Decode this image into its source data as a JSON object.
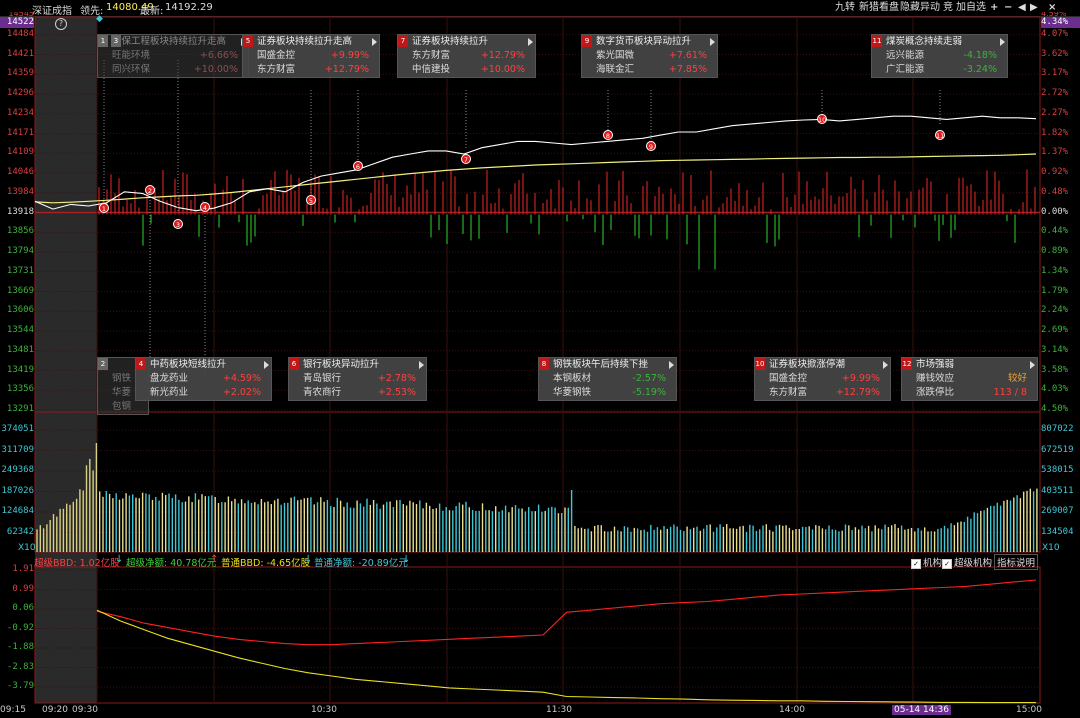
{
  "header": {
    "index_name": "深证成指",
    "prev_close_label": "领先:",
    "prev_close_value": "14080.49",
    "latest_label": "最新:",
    "latest_value": "14192.29",
    "top_left_value": "14522",
    "top_right_pct": "4.34%",
    "help_icon_label": "?"
  },
  "toolbar": {
    "items": [
      "九转",
      "新猎看盘",
      "隐藏异动",
      "竞",
      "加自选"
    ]
  },
  "price_axis": {
    "left_labels": [
      "14484",
      "14421",
      "14359",
      "14296",
      "14234",
      "14171",
      "14109",
      "14046",
      "13984",
      "13918",
      "13856",
      "13794",
      "13731",
      "13669",
      "13606",
      "13544",
      "13481",
      "13419",
      "13356",
      "13291"
    ],
    "right_labels": [
      "4.07%",
      "3.62%",
      "3.17%",
      "2.72%",
      "2.27%",
      "1.82%",
      "1.37%",
      "0.92%",
      "0.48%",
      "0.00%",
      "0.44%",
      "0.89%",
      "1.34%",
      "1.79%",
      "2.24%",
      "2.69%",
      "3.14%",
      "3.58%",
      "4.03%",
      "4.50%"
    ],
    "top_hidden_left": "14545",
    "top_hidden_right": "4.59%"
  },
  "volume_axis": {
    "left_labels": [
      "374051",
      "311709",
      "249368",
      "187026",
      "124684",
      "62342"
    ],
    "right_labels": [
      "807022",
      "672519",
      "538015",
      "403511",
      "269007",
      "134504"
    ],
    "multiplier": "X10"
  },
  "bbd_axis": {
    "left_labels": [
      "1.91",
      "0.99",
      "0.06",
      "-0.92",
      "-1.88",
      "-2.83",
      "-3.79"
    ]
  },
  "bbd_legend": {
    "super_bbd": "超级BBD: 1.02亿股",
    "super_net": "超级净额: 40.78亿元",
    "normal_bbd": "普通BBD: -4.65亿股",
    "normal_net": "普通净额: -20.89亿元",
    "chk_inst": "机构",
    "chk_super_inst": "超级机构",
    "indicator_help": "指标说明"
  },
  "time_axis": [
    "09:15",
    "09:20",
    "09:30",
    "10:30",
    "11:30",
    "14:00",
    "05-14 14:36",
    "15:00"
  ],
  "annotations_top": [
    {
      "num": "1",
      "title": "环保工程板块持续拉升走高",
      "rows": [
        [
          "旺能环境",
          "+6.66%"
        ],
        [
          "同兴环保",
          "+10.00%"
        ]
      ],
      "dim": true
    },
    {
      "num": "3",
      "title": "",
      "rows": [],
      "dim": true
    },
    {
      "num": "5",
      "title": "证券板块持续拉升走高",
      "rows": [
        [
          "国盛金控",
          "+9.99%"
        ],
        [
          "东方财富",
          "+12.79%"
        ]
      ],
      "dim": false
    },
    {
      "num": "7",
      "title": "证券板块持续拉升",
      "rows": [
        [
          "东方财富",
          "+12.79%"
        ],
        [
          "中信建投",
          "+10.00%"
        ]
      ],
      "dim": false
    },
    {
      "num": "9",
      "title": "数字货币板块异动拉升",
      "rows": [
        [
          "紫光国微",
          "+7.61%"
        ],
        [
          "海联金汇",
          "+7.85%"
        ]
      ],
      "dim": false
    },
    {
      "num": "11",
      "title": "煤炭概念持续走弱",
      "rows": [
        [
          "远兴能源",
          "-4.18%"
        ],
        [
          "广汇能源",
          "-3.24%"
        ]
      ],
      "dim": false
    }
  ],
  "annotations_bottom": [
    {
      "num": "2",
      "title": "",
      "rows": [
        [
          "钢铁",
          ""
        ],
        [
          "华菱",
          ""
        ],
        [
          "包钢",
          ""
        ]
      ],
      "dim": true
    },
    {
      "num": "4",
      "title": "中药板块短线拉升",
      "rows": [
        [
          "盘龙药业",
          "+4.59%"
        ],
        [
          "新光药业",
          "+2.02%"
        ]
      ],
      "dim": false
    },
    {
      "num": "6",
      "title": "银行板块异动拉升",
      "rows": [
        [
          "青岛银行",
          "+2.78%"
        ],
        [
          "青农商行",
          "+2.53%"
        ]
      ],
      "dim": false
    },
    {
      "num": "8",
      "title": "钢铁板块午后持续下挫",
      "rows": [
        [
          "本钢板材",
          "-2.57%"
        ],
        [
          "华菱钢铁",
          "-5.19%"
        ]
      ],
      "dim": false
    },
    {
      "num": "10",
      "title": "证券板块掀涨停潮",
      "rows": [
        [
          "国盛金控",
          "+9.99%"
        ],
        [
          "东方财富",
          "+12.79%"
        ]
      ],
      "dim": false
    },
    {
      "num": "12",
      "title": "市场强弱",
      "rows": [
        [
          "赚钱效应",
          "较好"
        ],
        [
          "涨跌停比",
          "113 / 8"
        ]
      ],
      "dim": false
    }
  ],
  "markers": [
    "1",
    "2",
    "3",
    "4",
    "5",
    "6",
    "7",
    "8",
    "9",
    "10",
    "11"
  ],
  "colors": {
    "up": "#ff3030",
    "down": "#27b027",
    "price_line": "#ffffff",
    "avg_line": "#f0f080",
    "super_bbd": "#ff2020",
    "normal_bbd": "#e8e020",
    "cyan": "#3fc7d6",
    "preopen": "#2a2a2a"
  },
  "chart_data": {
    "type": "line",
    "ylim": [
      13291,
      14545
    ],
    "prev_close": 13918,
    "price_series": [
      13960,
      13935,
      13950,
      13945,
      13955,
      13990,
      13985,
      13960,
      13940,
      13930,
      13938,
      13955,
      13990,
      14000,
      13990,
      14020,
      14040,
      14050,
      14060,
      14080,
      14100,
      14110,
      14120,
      14120,
      14110,
      14130,
      14140,
      14150,
      14150,
      14145,
      14140,
      14145,
      14150,
      14155,
      14160,
      14170,
      14180,
      14180,
      14190,
      14200,
      14205,
      14210,
      14215,
      14218,
      14220,
      14215,
      14220,
      14225,
      14230,
      14230,
      14225,
      14220,
      14225,
      14230,
      14225,
      14225,
      14222
    ],
    "avg_series": [
      13958,
      13955,
      13957,
      13960,
      13963,
      13967,
      13971,
      13974,
      13977,
      13979,
      13983,
      13988,
      13994,
      14000,
      14006,
      14012,
      14018,
      14024,
      14030,
      14036,
      14042,
      14048,
      14053,
      14058,
      14062,
      14066,
      14069,
      14072,
      14075,
      14077,
      14079,
      14081,
      14083,
      14085,
      14087,
      14089,
      14090,
      14091,
      14092,
      14093,
      14094,
      14095,
      14096,
      14097,
      14098,
      14099,
      14099,
      14100,
      14100,
      14101,
      14102,
      14103,
      14104,
      14105,
      14106,
      14108,
      14110
    ],
    "bbd_ylim": [
      -4.3,
      2.0
    ],
    "super_bbd": [
      -0.05,
      -0.3,
      -0.6,
      -0.8,
      -1.0,
      -1.2,
      -1.35,
      -1.45,
      -1.55,
      -1.6,
      -1.6,
      -1.55,
      -1.5,
      -1.45,
      -1.4,
      -1.35,
      -1.3,
      -1.25,
      -1.2,
      -1.15,
      -0.1,
      0.0,
      0.1,
      0.2,
      0.3,
      0.35,
      0.4,
      0.5,
      0.6,
      0.7,
      0.75,
      0.8,
      0.85,
      0.9,
      0.95,
      1.0,
      1.05,
      1.1,
      1.2,
      1.3,
      1.4
    ],
    "normal_bbd": [
      0.0,
      -0.5,
      -0.9,
      -1.3,
      -1.6,
      -1.9,
      -2.2,
      -2.45,
      -2.7,
      -2.9,
      -3.05,
      -3.2,
      -3.3,
      -3.4,
      -3.5,
      -3.6,
      -3.65,
      -3.7,
      -3.75,
      -3.8,
      -4.0,
      -4.02,
      -4.05,
      -4.07,
      -4.1,
      -4.12,
      -4.15,
      -4.17,
      -4.18,
      -4.2,
      -4.2,
      -4.22,
      -4.23,
      -4.24,
      -4.25,
      -4.26,
      -4.27,
      -4.27,
      -4.28,
      -4.28,
      -4.28
    ]
  }
}
